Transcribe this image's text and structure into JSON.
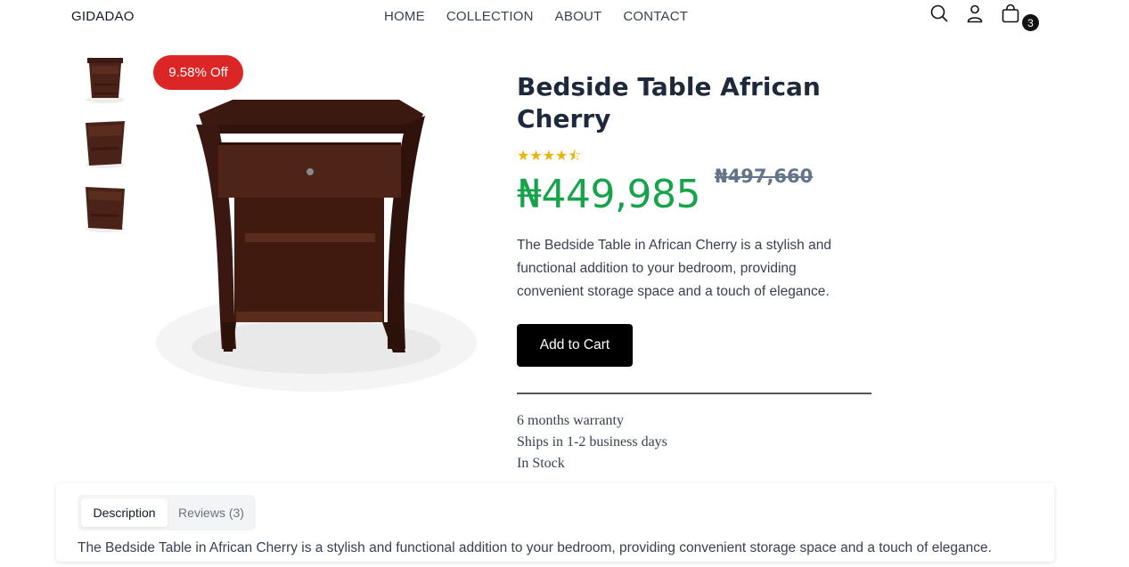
{
  "header": {
    "logo": "GIDADAO",
    "nav": [
      "HOME",
      "COLLECTION",
      "ABOUT",
      "CONTACT"
    ],
    "cart_count": "3",
    "icons": [
      "search-icon",
      "user-icon",
      "cart-icon"
    ]
  },
  "gallery": {
    "thumbnail_count": 3,
    "discount_badge": "9.58% Off"
  },
  "product": {
    "title": "Bedside Table African Cherry",
    "rating_stars": "★★★★⯪",
    "rating_value": 4.5,
    "price": "₦449,985",
    "old_price": "₦497,660",
    "short_description": "The Bedside Table in African Cherry is a stylish and functional addition to your bedroom, providing convenient storage space and a touch of elegance.",
    "add_to_cart_label": "Add to Cart",
    "info": [
      "6 months warranty",
      "Ships in 1-2 business days",
      "In Stock"
    ]
  },
  "tabs": {
    "items": [
      "Description",
      "Reviews (3)"
    ],
    "active": "Description",
    "content": "The Bedside Table in African Cherry is a stylish and functional addition to your bedroom, providing convenient storage space and a touch of elegance."
  },
  "colors": {
    "price": "#16a34a",
    "badge": "#dc2626",
    "stars": "#eab308",
    "wood": "#4a2218"
  }
}
